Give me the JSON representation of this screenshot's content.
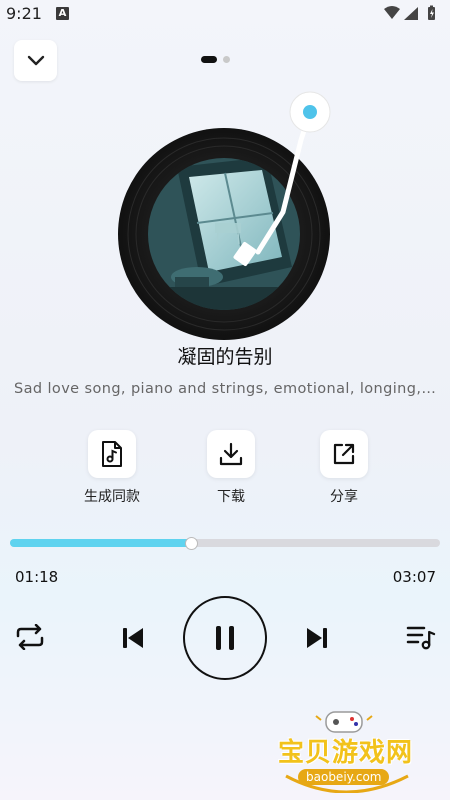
{
  "status_bar": {
    "time": "9:21",
    "notif_icon": "A"
  },
  "header": {
    "back_icon": "chevron-down-icon",
    "pager": {
      "count": 2,
      "active": 1
    }
  },
  "song": {
    "title": "凝固的告别",
    "description": "Sad love song, piano and strings, emotional, longing,…"
  },
  "actions": [
    {
      "label": "生成同款",
      "icon": "music-file-icon"
    },
    {
      "label": "下载",
      "icon": "download-icon"
    },
    {
      "label": "分享",
      "icon": "share-icon"
    }
  ],
  "player": {
    "current_time": "01:18",
    "total_time": "03:07",
    "progress_percent": 42,
    "accent": "#5fd3ef"
  },
  "watermark": {
    "text": "宝贝游戏网",
    "url": "baobeiy.com"
  }
}
